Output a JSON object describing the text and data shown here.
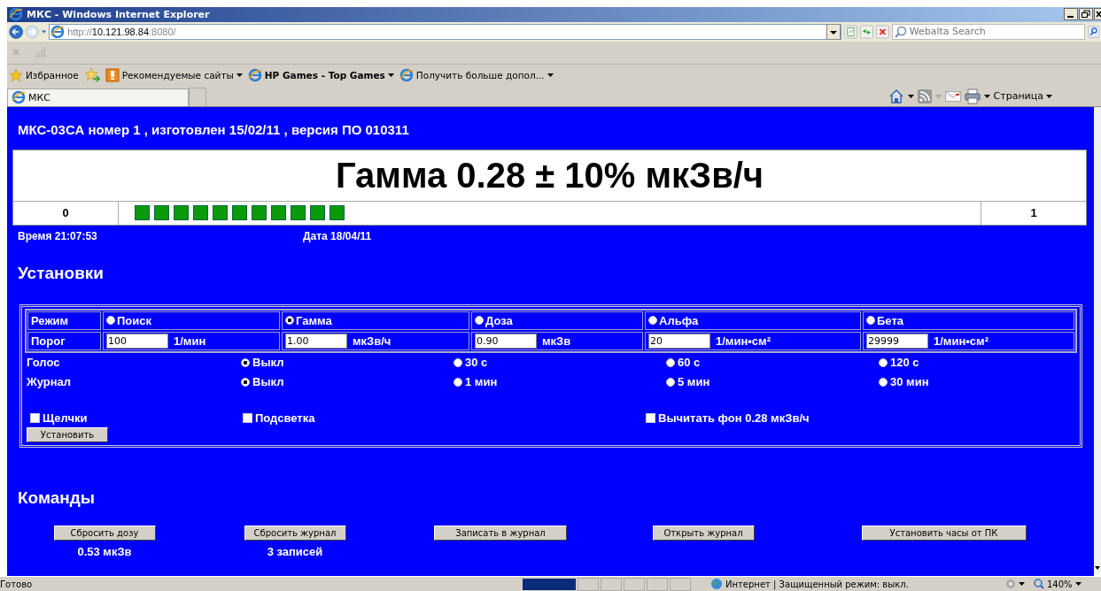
{
  "window": {
    "title": "МКС - Windows Internet Explorer"
  },
  "address_bar": {
    "url": "http://**10.121.98.84**:8080/",
    "search_placeholder": "Webalta Search"
  },
  "favorites_bar": {
    "items": [
      {
        "kind": "star",
        "label": "Избранное",
        "bold": false
      },
      {
        "kind": "site",
        "label": "Рекомендуемые сайты",
        "bold": false
      },
      {
        "kind": "ie",
        "label": "HP Games - Top Games",
        "bold": true
      },
      {
        "kind": "ie",
        "label": "Получить больше допол...",
        "bold": false
      }
    ]
  },
  "tabs": [
    {
      "label": "МКС",
      "selected": true
    }
  ],
  "command_bar": {
    "page_menu": "Страница"
  },
  "page": {
    "header": "МКС-03СА номер 1 , изготовлен 15/02/11 , версия ПО 010311",
    "reading": "Гамма 0.28 ± 10% мкЗв/ч",
    "scale": {
      "min": "0",
      "max": "1"
    },
    "time": "Время 21:07:53",
    "date": "Дата 18/04/11",
    "settings": {
      "title": "Установки",
      "mode_label": "Режим",
      "threshold_label": "Порог",
      "modes": [
        {
          "label": "Поиск",
          "selected": false,
          "threshold": "100",
          "unit": "1/мин"
        },
        {
          "label": "Гамма",
          "selected": true,
          "threshold": "1.00",
          "unit": "мкЗв/ч"
        },
        {
          "label": "Доза",
          "selected": false,
          "threshold": "0.90",
          "unit": "мкЗв"
        },
        {
          "label": "Альфа",
          "selected": false,
          "threshold": "20",
          "unit": "1/мин•см²"
        },
        {
          "label": "Бета",
          "selected": false,
          "threshold": "29999",
          "unit": "1/мин•см²"
        }
      ],
      "option_groups": [
        {
          "label": "Голос",
          "options": [
            {
              "label": "Выкл",
              "selected": true
            },
            {
              "label": "30 с",
              "selected": false
            },
            {
              "label": "60 с",
              "selected": false
            },
            {
              "label": "120 с",
              "selected": false
            }
          ]
        },
        {
          "label": "Журнал",
          "options": [
            {
              "label": "Выкл",
              "selected": true
            },
            {
              "label": "1 мин",
              "selected": false
            },
            {
              "label": "5 мин",
              "selected": false
            },
            {
              "label": "30 мин",
              "selected": false
            }
          ]
        }
      ],
      "checkboxes": [
        {
          "label": "Щелчки",
          "checked": false
        },
        {
          "label": "Подсветка",
          "checked": false
        },
        {
          "label": "Вычитать фон 0.28 мкЗв/ч",
          "checked": false
        }
      ],
      "apply_button": "Установить"
    },
    "commands": {
      "title": "Команды",
      "items": [
        {
          "button": "Сбросить дозу",
          "value": "0.53 мкЗв"
        },
        {
          "button": "Сбросить журнал",
          "value": "3 записей"
        },
        {
          "button": "Записать в журнал"
        },
        {
          "button": "Открыть журнал"
        },
        {
          "button": "Установить часы от ПК"
        }
      ]
    }
  },
  "status_bar": {
    "text": "Готово",
    "zone": "Интернет | Защищенный режим: выкл.",
    "zoom": "140%"
  }
}
